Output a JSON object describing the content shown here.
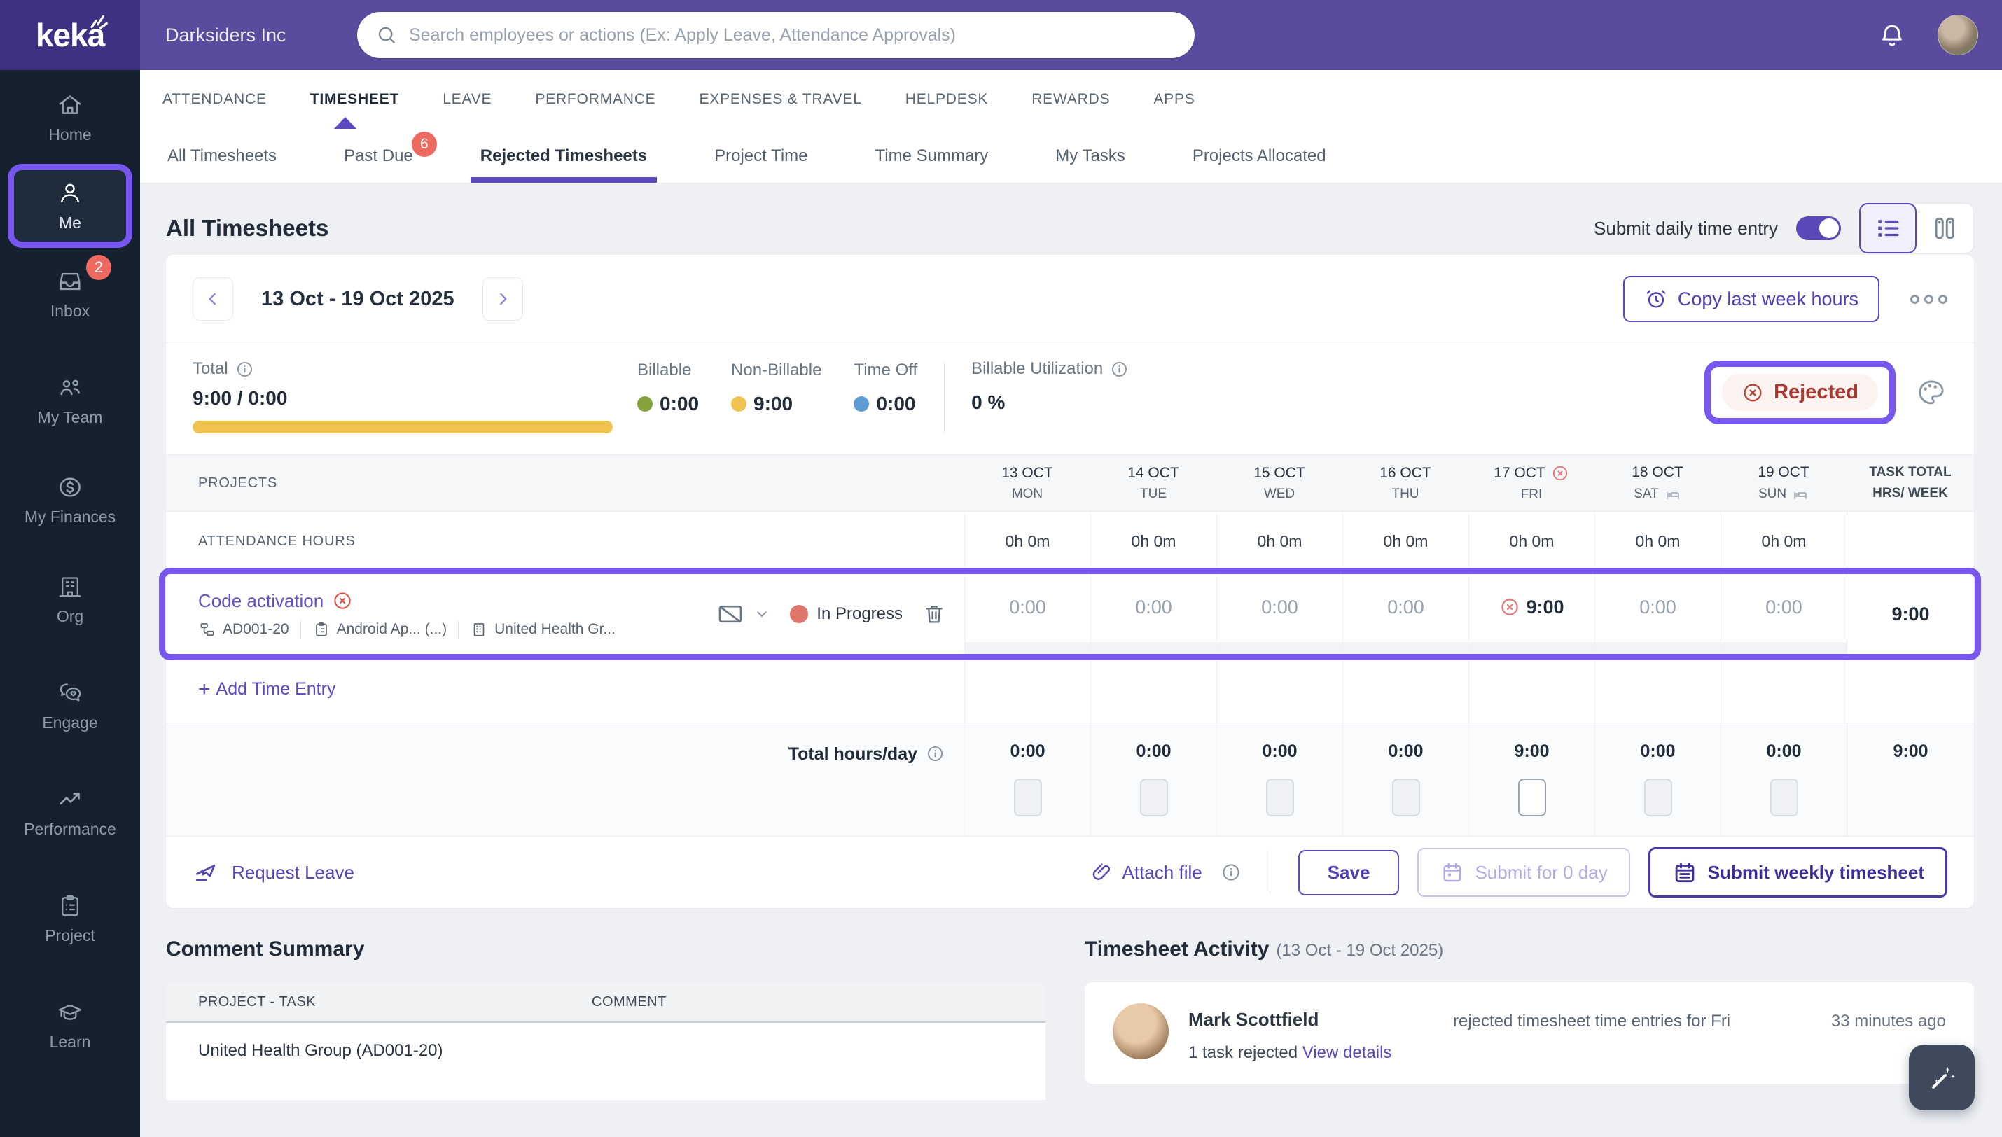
{
  "colors": {
    "accent": "#5a49b8",
    "annotation": "#7857f0",
    "topbar": "#5b4b9e",
    "badge_red": "#ee6a60",
    "rejected_red": "#a93a32",
    "progress_yellow": "#f0c351",
    "billable_green": "#85a33d",
    "nonbillable_yellow": "#eec351",
    "timeoff_blue": "#5d9bd3",
    "inprogress_dot": "#e0756c"
  },
  "topbar": {
    "logo": "keka",
    "company": "Darksiders Inc",
    "search_placeholder": "Search employees or actions (Ex: Apply Leave, Attendance Approvals)"
  },
  "sidebar": {
    "items": [
      {
        "label": "Home"
      },
      {
        "label": "Me"
      },
      {
        "label": "Inbox",
        "badge": "2"
      },
      {
        "label": "My Team"
      },
      {
        "label": "My Finances"
      },
      {
        "label": "Org"
      },
      {
        "label": "Engage"
      },
      {
        "label": "Performance"
      },
      {
        "label": "Project"
      },
      {
        "label": "Learn"
      }
    ]
  },
  "main_nav": {
    "tabs": [
      {
        "label": "ATTENDANCE"
      },
      {
        "label": "TIMESHEET"
      },
      {
        "label": "LEAVE"
      },
      {
        "label": "PERFORMANCE"
      },
      {
        "label": "EXPENSES & TRAVEL"
      },
      {
        "label": "HELPDESK"
      },
      {
        "label": "REWARDS"
      },
      {
        "label": "APPS"
      }
    ]
  },
  "sub_nav": {
    "tabs": [
      {
        "label": "All Timesheets"
      },
      {
        "label": "Past Due",
        "badge": "6"
      },
      {
        "label": "Rejected Timesheets"
      },
      {
        "label": "Project Time"
      },
      {
        "label": "Time Summary"
      },
      {
        "label": "My Tasks"
      },
      {
        "label": "Projects Allocated"
      }
    ]
  },
  "page": {
    "title": "All Timesheets",
    "toggle_label": "Submit daily time entry"
  },
  "week": {
    "range": "13 Oct - 19 Oct 2025",
    "copy_label": "Copy last week hours"
  },
  "summary": {
    "total_label": "Total",
    "total_value": "9:00 / 0:00",
    "stats": [
      {
        "label": "Billable",
        "value": "0:00"
      },
      {
        "label": "Non-Billable",
        "value": "9:00"
      },
      {
        "label": "Time Off",
        "value": "0:00"
      }
    ],
    "utilization_label": "Billable Utilization",
    "utilization_value": "0 %",
    "status": "Rejected"
  },
  "table": {
    "projects_header": "PROJECTS",
    "days": [
      {
        "date": "13 OCT",
        "day": "MON"
      },
      {
        "date": "14 OCT",
        "day": "TUE"
      },
      {
        "date": "15 OCT",
        "day": "WED"
      },
      {
        "date": "16 OCT",
        "day": "THU"
      },
      {
        "date": "17 OCT",
        "day": "FRI",
        "rejected": true
      },
      {
        "date": "18 OCT",
        "day": "SAT",
        "weekend": true
      },
      {
        "date": "19 OCT",
        "day": "SUN",
        "weekend": true
      }
    ],
    "total_header_1": "TASK TOTAL",
    "total_header_2": "HRS/ WEEK",
    "attendance_label": "ATTENDANCE HOURS",
    "attendance_values": [
      "0h 0m",
      "0h 0m",
      "0h 0m",
      "0h 0m",
      "0h 0m",
      "0h 0m",
      "0h 0m"
    ],
    "project": {
      "name": "Code activation",
      "id": "AD001-20",
      "task": "Android Ap... (...)",
      "client": "United Health Gr...",
      "status": "In Progress",
      "values": [
        "0:00",
        "0:00",
        "0:00",
        "0:00",
        "9:00",
        "0:00",
        "0:00"
      ],
      "total": "9:00"
    },
    "add_icon": "+",
    "add_entry": "Add Time Entry",
    "totals_label": "Total hours/day",
    "totals_values": [
      "0:00",
      "0:00",
      "0:00",
      "0:00",
      "9:00",
      "0:00",
      "0:00"
    ],
    "week_total": "9:00"
  },
  "actions": {
    "request_leave": "Request Leave",
    "attach_file": "Attach file",
    "save": "Save",
    "submit_day": "Submit for 0 day",
    "submit_week": "Submit weekly timesheet"
  },
  "comment_summary": {
    "title": "Comment Summary",
    "col_project": "PROJECT - TASK",
    "col_comment": "COMMENT",
    "rows": [
      {
        "project_task": "United Health Group (AD001-20)",
        "comment": ""
      }
    ]
  },
  "activity": {
    "title": "Timesheet Activity",
    "range": "(13 Oct - 19 Oct 2025)",
    "entries": [
      {
        "name": "Mark Scottfield",
        "action": "rejected timesheet time entries for Fri",
        "time": "33 minutes ago",
        "detail": "1 task rejected",
        "link": "View details"
      }
    ]
  }
}
